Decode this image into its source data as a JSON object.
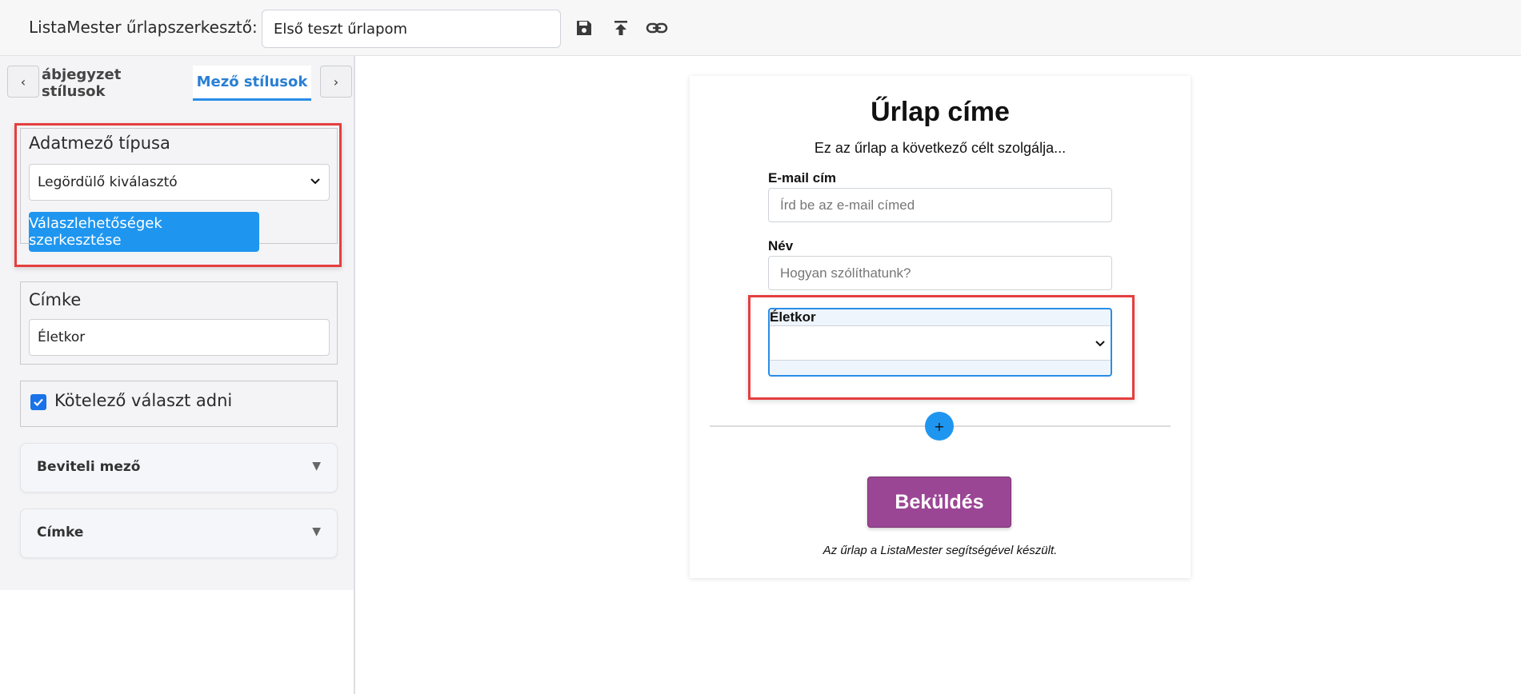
{
  "header": {
    "app_title": "ListaMester űrlapszerkesztő:",
    "form_name": "Első teszt űrlapom",
    "icons": [
      "save-icon",
      "upload-icon",
      "link-icon"
    ]
  },
  "sidebar": {
    "tab_prev": "‹",
    "tab_next": "›",
    "tabs": [
      {
        "label": "ábjegyzet stílusok",
        "active": false
      },
      {
        "label": "Mező stílusok",
        "active": true
      }
    ],
    "field_type": {
      "label": "Adatmező típusa",
      "value": "Legördülő kiválasztó",
      "edit_button": "Válaszlehetőségek szerkesztése"
    },
    "label_card": {
      "label": "Címke",
      "value": "Életkor"
    },
    "required": {
      "checked": true,
      "label": "Kötelező választ adni"
    },
    "accordions": [
      {
        "title": "Beviteli mező",
        "caret": "▼"
      },
      {
        "title": "Címke",
        "caret": "▼"
      }
    ]
  },
  "form": {
    "title": "Űrlap címe",
    "subtitle": "Ez az űrlap a következő célt szolgálja...",
    "fields": [
      {
        "label": "E-mail cím",
        "placeholder": "Írd be az e-mail címed"
      },
      {
        "label": "Név",
        "placeholder": "Hogyan szólíthatunk?"
      }
    ],
    "selected_field": {
      "label": "Életkor"
    },
    "add_button": "+",
    "submit": "Beküldés",
    "footer": "Az űrlap a ListaMester segítségével készült."
  },
  "colors": {
    "accent": "#1e96f0",
    "highlight": "#e53e3e",
    "submit": "#9b4695"
  }
}
